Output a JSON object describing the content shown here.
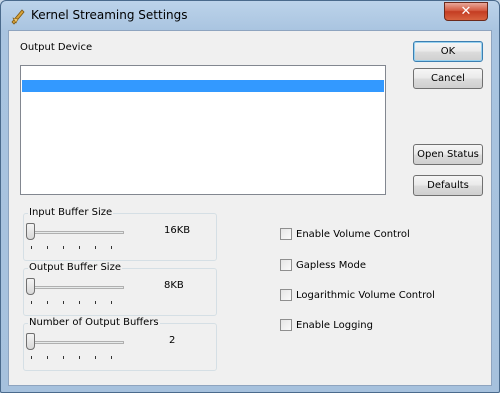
{
  "window": {
    "title": "Kernel Streaming Settings",
    "close_glyph": "✕"
  },
  "output_device": {
    "label": "Output Device",
    "items": [
      ""
    ],
    "selected_index": 0
  },
  "buttons": {
    "ok": "OK",
    "cancel": "Cancel",
    "open_status": "Open Status",
    "defaults": "Defaults"
  },
  "sliders": {
    "input_buffer": {
      "label": "Input Buffer Size",
      "value": "16KB",
      "position": 0
    },
    "output_buffer": {
      "label": "Output Buffer Size",
      "value": "8KB",
      "position": 0
    },
    "num_output_buffers": {
      "label": "Number of Output Buffers",
      "value": "2",
      "position": 0
    }
  },
  "checkboxes": [
    {
      "label": "Enable Volume Control",
      "checked": false
    },
    {
      "label": "Gapless Mode",
      "checked": false
    },
    {
      "label": "Logarithmic Volume Control",
      "checked": false
    },
    {
      "label": "Enable Logging",
      "checked": false
    }
  ],
  "icons": {
    "title_icon": "music-note-icon",
    "close": "close-icon"
  },
  "colors": {
    "selection": "#3399ff",
    "close_button": "#c43c22",
    "titlebar": "#bcd3ea"
  }
}
